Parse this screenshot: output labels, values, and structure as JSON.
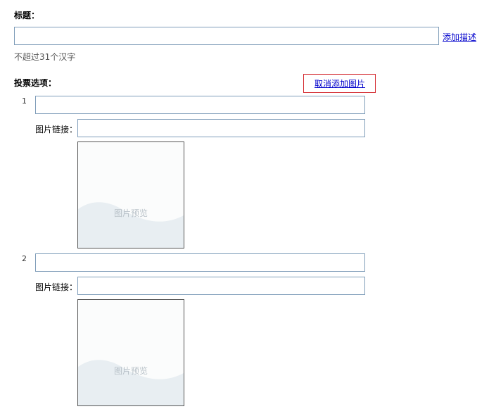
{
  "title_section": {
    "label": "标题：",
    "value": "",
    "add_description_link": "添加描述",
    "hint": "不超过31个汉字"
  },
  "vote_section": {
    "label": "投票选项：",
    "cancel_image_link": "取消添加图片",
    "image_link_label": "图片链接：",
    "preview_text": "图片预览",
    "options": [
      {
        "number": "1",
        "value": "",
        "image_url": ""
      },
      {
        "number": "2",
        "value": "",
        "image_url": ""
      }
    ]
  },
  "colors": {
    "link": "#0000cc",
    "input_border": "#7f9db9",
    "highlight_border": "#d4282e",
    "preview_wave": "#e8eef2"
  }
}
